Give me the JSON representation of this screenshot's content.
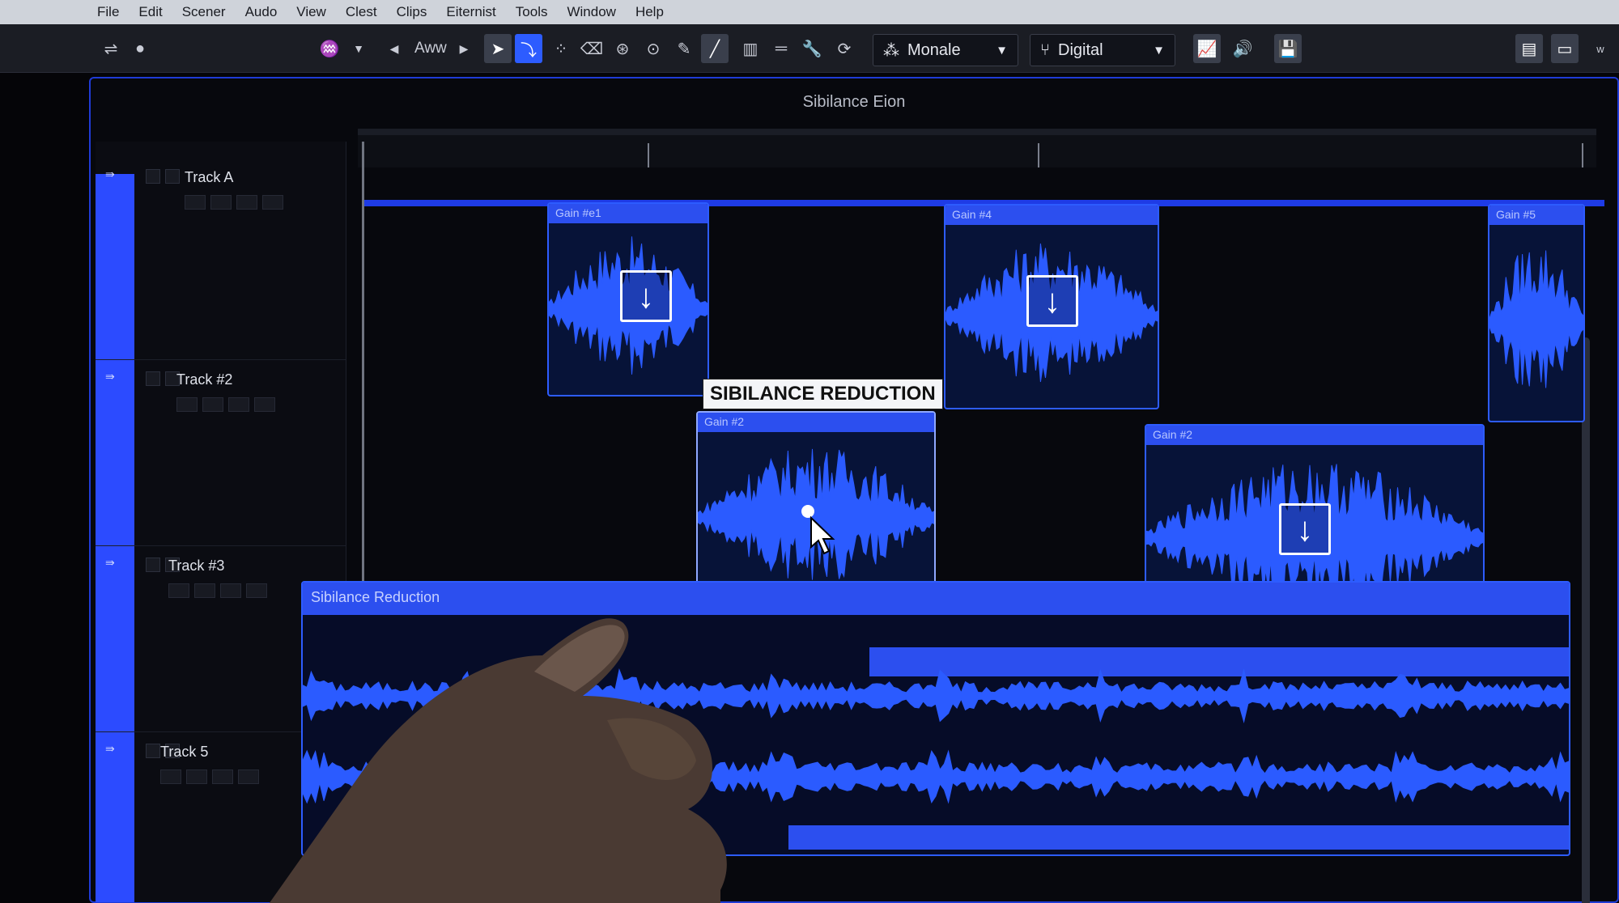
{
  "menu": [
    "File",
    "Edit",
    "Scener",
    "Audo",
    "View",
    "Clest",
    "Clips",
    "Eiternist",
    "Tools",
    "Window",
    "Help"
  ],
  "toolbar": {
    "nav_label": "Aww",
    "preset_label": "Monale",
    "mode_label": "Digital"
  },
  "window": {
    "title": "Sibilance Eion"
  },
  "tracks": [
    {
      "name": "Track A"
    },
    {
      "name": "Track #2"
    },
    {
      "name": "Track #3"
    },
    {
      "name": "Track 5"
    }
  ],
  "clips": {
    "gain1": "Gain #e1",
    "gain4": "Gain #4",
    "gain5": "Gain #5",
    "gain2a": "Gain #2",
    "gain2b": "Gain #2",
    "long": "Sibilance Reduction"
  },
  "overlay_label": "SIBILANCE REDUCTION",
  "colors": {
    "accent": "#2d5cff",
    "clip_bg": "#071338",
    "wave": "#2b5bff"
  }
}
